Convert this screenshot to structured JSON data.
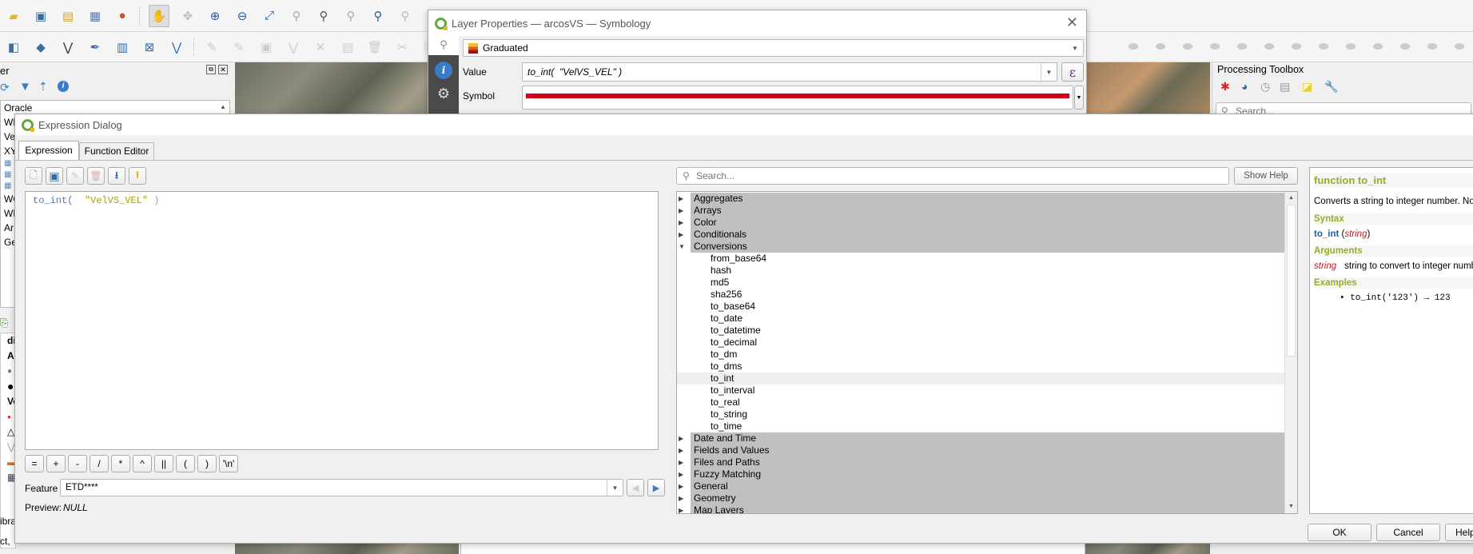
{
  "toolbar_top": {
    "icons": [
      "open-folder-icon",
      "save-project-icon",
      "new-print-layout-icon",
      "layout-manager-icon",
      "style-manager-icon",
      "pan-hand-icon",
      "pan-to-selection-icon",
      "zoom-in-icon",
      "zoom-out-icon",
      "zoom-full-icon",
      "zoom-to-selection-icon",
      "zoom-to-layer-icon",
      "zoom-native-icon",
      "zoom-last-icon",
      "zoom-next-icon"
    ]
  },
  "browser_panel": {
    "title_fragment": "er",
    "items": [
      "Oracle",
      "WMS",
      "Ve",
      "XY",
      "WC",
      "WF",
      "Ar",
      "Ge"
    ],
    "layer_fragments": [
      "di",
      "Ac",
      "Ve"
    ],
    "bottom_fragments": [
      "ibra",
      "ct,"
    ]
  },
  "processing_toolbox": {
    "title": "Processing Toolbox",
    "search_placeholder": "Search..."
  },
  "layer_properties": {
    "title": "Layer Properties — arcosVS — Symbology",
    "renderer": "Graduated",
    "value_label": "Value",
    "value": "to_int(  \"VelVS_VEL\" )",
    "symbol_label": "Symbol",
    "symbol_color": "#d0021b",
    "epsilon_glyph": "ε"
  },
  "expression_dialog": {
    "title": "Expression Dialog",
    "tabs": [
      {
        "label": "Expression",
        "active": true
      },
      {
        "label": "Function Editor",
        "active": false
      }
    ],
    "expression_tokens": [
      {
        "text": "to_int(",
        "color": "#4a7ab9"
      },
      {
        "text": "  \"VelVS_VEL\"",
        "color": "#a8a300"
      },
      {
        "text": " )",
        "color": "#b48ac8"
      }
    ],
    "operators": [
      "=",
      "+",
      "-",
      "/",
      "*",
      "^",
      "||",
      "(",
      ")",
      "'\\n'"
    ],
    "feature_label": "Feature",
    "feature_value": "ETD****",
    "preview_label": "Preview:",
    "preview_value": "NULL",
    "search_placeholder": "Search...",
    "show_help_label": "Show Help",
    "tree_groups_before": [
      "Aggregates",
      "Arrays",
      "Color",
      "Conditionals"
    ],
    "expanded_group": "Conversions",
    "conversion_items": [
      "from_base64",
      "hash",
      "md5",
      "sha256",
      "to_base64",
      "to_date",
      "to_datetime",
      "to_decimal",
      "to_dm",
      "to_dms",
      "to_int",
      "to_interval",
      "to_real",
      "to_string",
      "to_time"
    ],
    "selected_item": "to_int",
    "tree_groups_after": [
      "Date and Time",
      "Fields and Values",
      "Files and Paths",
      "Fuzzy Matching",
      "General",
      "Geometry",
      "Map Layers"
    ],
    "help": {
      "title": "function to_int",
      "description": "Converts a string to integer number. Nothing is returned if a value cannot be converted to integer (e.g '123asd' is invalid).",
      "syntax_header": "Syntax",
      "syntax_fn": "to_int",
      "syntax_arg": "string",
      "arguments_header": "Arguments",
      "arg_name": "string",
      "arg_desc": "string to convert to integer number",
      "examples_header": "Examples",
      "example": "to_int('123') → 123"
    },
    "ok_label": "OK",
    "cancel_label": "Cancel",
    "help_label": "Help"
  }
}
